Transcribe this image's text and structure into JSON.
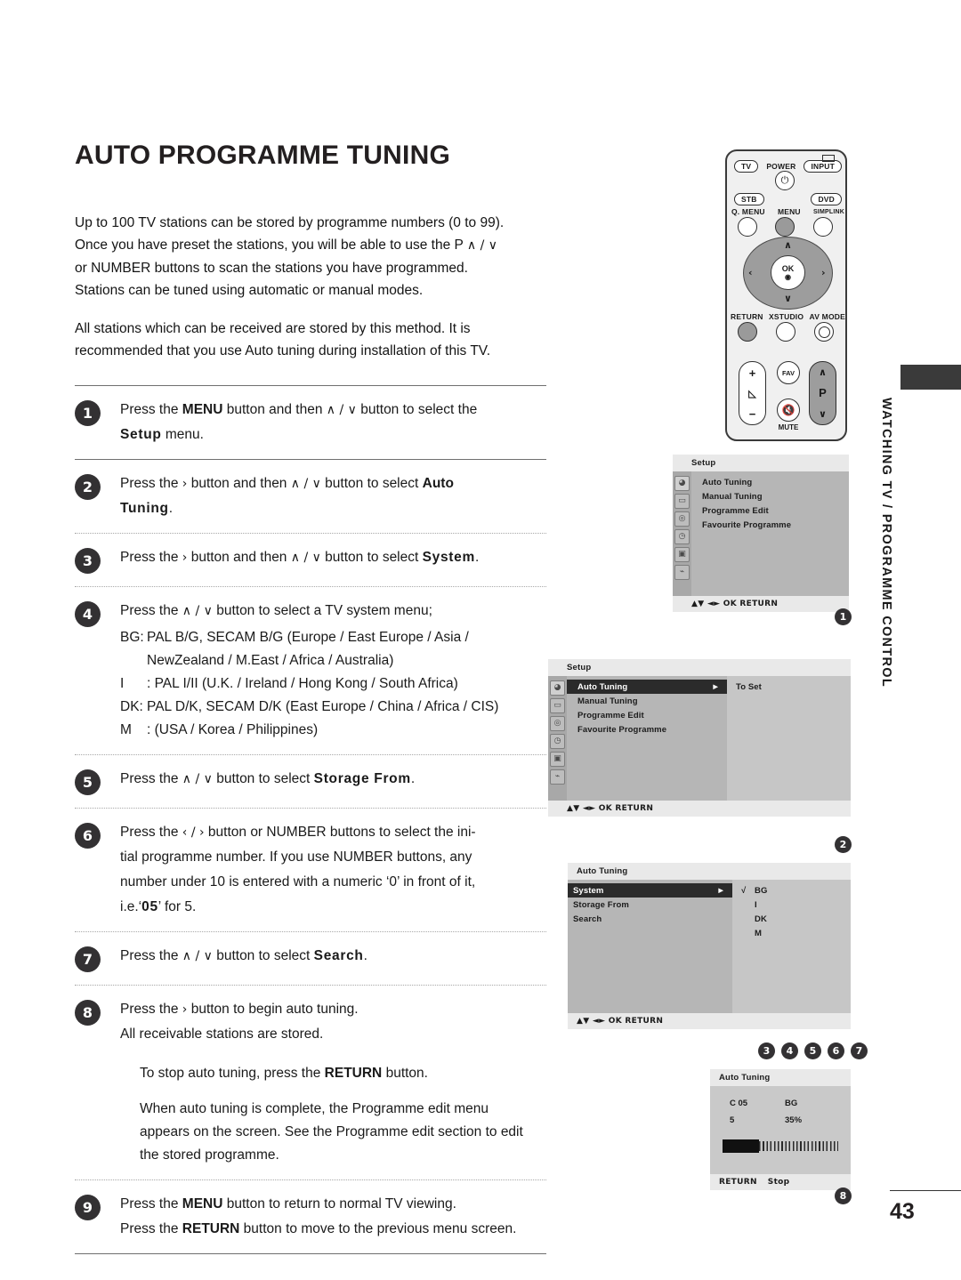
{
  "page": {
    "title": "AUTO PROGRAMME TUNING",
    "number": "43",
    "side_label": "WATCHING TV / PROGRAMME CONTROL"
  },
  "intro": {
    "p1_line1": "Up to 100 TV stations can be stored by programme numbers (0 to 99).",
    "p1_line2_a": "Once you have preset the stations, you will be able to use the P",
    "p1_line2_arrows": "∧ / ∨",
    "p1_line3": "or NUMBER buttons to scan the stations you have programmed.",
    "p1_line4": "Stations can be tuned using automatic or manual modes.",
    "p2_line1": "All stations which can be received are stored by this method. It is",
    "p2_line2": "recommended that you use Auto tuning during installation of this TV."
  },
  "steps": [
    {
      "num": "1",
      "l1_a": "Press the ",
      "l1_b": "MENU",
      "l1_c": " button and then ",
      "l1_arrows": "∧ / ∨",
      "l1_d": " button to select the",
      "l2_b": "Setup",
      "l2_c": " menu."
    },
    {
      "num": "2",
      "l1_a": "Press the ",
      "l1_arrow": "›",
      "l1_b": " button and then ",
      "l1_arrows": "∧ / ∨",
      "l1_c": " button to select ",
      "l1_d": "Auto",
      "l2_b": "Tuning",
      "l2_c": "."
    },
    {
      "num": "3",
      "l1_a": "Press the ",
      "l1_arrow": "›",
      "l1_b": " button and then ",
      "l1_arrows": "∧ / ∨",
      "l1_c": " button to select ",
      "l1_d": "System",
      "l1_e": "."
    },
    {
      "num": "4",
      "l1_a": "Press the ",
      "l1_arrows": "∧ / ∨",
      "l1_b": " button to select a TV system menu;",
      "systems": [
        {
          "key": "BG:",
          "value": "PAL B/G, SECAM B/G (Europe / East Europe / Asia /",
          "cont": "NewZealand / M.East / Africa / Australia)"
        },
        {
          "key": "I",
          "value": ": PAL I/II (U.K. / Ireland / Hong Kong / South Africa)"
        },
        {
          "key": "DK:",
          "value": "PAL D/K, SECAM D/K (East Europe / China / Africa / CIS)"
        },
        {
          "key": "M",
          "value": ": (USA / Korea / Philippines)"
        }
      ]
    },
    {
      "num": "5",
      "l1_a": "Press the ",
      "l1_arrows": "∧ / ∨",
      "l1_b": " button to select ",
      "l1_c": "Storage From",
      "l1_d": "."
    },
    {
      "num": "6",
      "l1_a": "Press the ",
      "l1_arrows": "‹ / ›",
      "l1_b": " button or NUMBER buttons to select the ini-",
      "l2": "tial programme number. If you use NUMBER buttons, any",
      "l3": "number under 10 is entered with a numeric ‘0’ in front of it,",
      "l4_a": "i.e.‘",
      "l4_b": "05",
      "l4_c": "’ for 5."
    },
    {
      "num": "7",
      "l1_a": "Press the ",
      "l1_arrows": "∧ / ∨",
      "l1_b": " button to select ",
      "l1_c": "Search",
      "l1_d": "."
    },
    {
      "num": "8",
      "l1_a": "Press the ",
      "l1_arrow": "›",
      "l1_b": " button to begin auto tuning.",
      "l2": "All receivable stations are stored."
    },
    {
      "num": "9",
      "l1_a": "Press the ",
      "l1_b": "MENU",
      "l1_c": " button to return to normal TV viewing.",
      "l2_a": "Press the ",
      "l2_b": "RETURN",
      "l2_c": " button to move to the previous menu screen."
    }
  ],
  "note": {
    "l1_a": "To stop auto tuning, press the ",
    "l1_b": "RETURN",
    "l1_c": " button.",
    "l2": "When auto tuning is complete, the Programme edit menu",
    "l3": "appears on the screen. See the Programme edit section to edit",
    "l4": "the stored programme."
  },
  "remote": {
    "tv": "TV",
    "power": "POWER",
    "input": "INPUT",
    "stb": "STB",
    "dvd": "DVD",
    "q_menu": "Q. MENU",
    "menu": "MENU",
    "simplink": "SIMPLINK",
    "ok": "OK",
    "up": "∧",
    "down": "∨",
    "left": "‹",
    "right": "›",
    "return": "RETURN",
    "xstudio": "XSTUDIO",
    "av_mode": "AV MODE",
    "plus": "+",
    "minus": "−",
    "fav": "FAV",
    "mute": "MUTE",
    "p": "P",
    "p_up": "∧",
    "p_down": "∨"
  },
  "osd1": {
    "title": "Setup",
    "items": [
      "Auto Tuning",
      "Manual Tuning",
      "Programme Edit",
      "Favourite Programme"
    ],
    "footer": "▲▼  ◄►  OK  RETURN",
    "badge": "1"
  },
  "osd2": {
    "title": "Setup",
    "items": [
      "Auto Tuning",
      "Manual Tuning",
      "Programme Edit",
      "Favourite Programme"
    ],
    "selected_index": 0,
    "selected_arrow": "►",
    "right_items": [
      "To Set"
    ],
    "footer": "▲▼  ◄►  OK  RETURN",
    "badge": "2"
  },
  "osd3": {
    "title": "Auto Tuning",
    "items": [
      "System",
      "Storage From",
      "Search"
    ],
    "selected_index": 0,
    "selected_arrow": "►",
    "right_items": [
      {
        "check": "√",
        "label": "BG"
      },
      {
        "check": "",
        "label": "I"
      },
      {
        "check": "",
        "label": "DK"
      },
      {
        "check": "",
        "label": "M"
      }
    ],
    "footer": "▲▼  ◄►  OK  RETURN",
    "badges": [
      "3",
      "4",
      "5",
      "6",
      "7"
    ]
  },
  "osd4": {
    "title": "Auto Tuning",
    "channel": "C 05",
    "system": "BG",
    "stored": "5",
    "percent": "35%",
    "progress": 35,
    "footer_return": "RETURN",
    "footer_stop": "Stop",
    "badge": "8"
  },
  "colors": {
    "badge_bg": "#333133",
    "osd_title_bg": "#e9e9e9",
    "osd_body_bg": "#b6b6b6",
    "osd_selected_bg": "#2b2b2b",
    "tab_bg": "#3a3a3a"
  }
}
